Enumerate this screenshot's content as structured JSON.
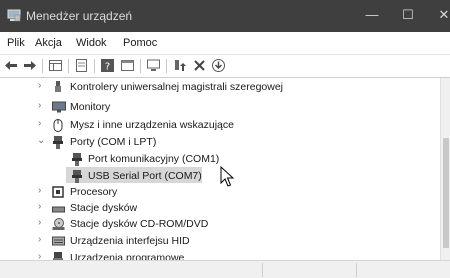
{
  "window": {
    "title": "Menedżer urządzeń",
    "controls": {
      "minimize": "—",
      "maximize": "☐",
      "close": "✕"
    }
  },
  "menu": [
    "Plik",
    "Akcja",
    "Widok",
    "Pomoc"
  ],
  "tree": {
    "items": [
      {
        "label": "Kontrolery uniwersalnej magistrali szeregowej",
        "expanded": false,
        "icon": "usb-icon"
      },
      {
        "label": "Monitory",
        "expanded": false,
        "icon": "monitor-icon"
      },
      {
        "label": "Mysz i inne urządzenia wskazujące",
        "expanded": false,
        "icon": "mouse-icon"
      },
      {
        "label": "Porty (COM i LPT)",
        "expanded": true,
        "icon": "port-icon",
        "children": [
          {
            "label": "Port komunikacyjny (COM1)",
            "icon": "port-icon",
            "selected": false
          },
          {
            "label": "USB Serial Port (COM7)",
            "icon": "port-icon",
            "selected": true
          }
        ]
      },
      {
        "label": "Procesory",
        "expanded": false,
        "icon": "cpu-icon"
      },
      {
        "label": "Stacje dysków",
        "expanded": false,
        "icon": "disk-icon"
      },
      {
        "label": "Stacje dysków CD-ROM/DVD",
        "expanded": false,
        "icon": "cdrom-icon"
      },
      {
        "label": "Urządzenia interfejsu HID",
        "expanded": false,
        "icon": "hid-icon"
      },
      {
        "label": "Urządzenia programowe",
        "expanded": false,
        "icon": "software-icon"
      }
    ],
    "chevron_collapsed": "›",
    "chevron_expanded": "⌄"
  },
  "colors": {
    "titlebar": "#3f3f3f",
    "selection": "#d7d7d7"
  }
}
